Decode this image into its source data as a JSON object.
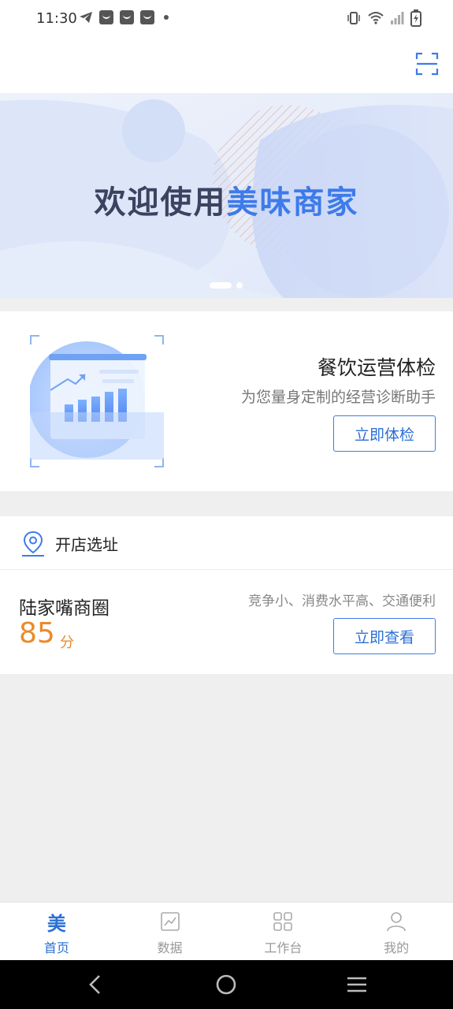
{
  "status_bar": {
    "time": "11:30",
    "notification_icons": [
      "telegram-icon",
      "mail-icon",
      "mail-icon",
      "mail-icon",
      "more-dot-icon"
    ],
    "system_icons": [
      "vibrate-icon",
      "wifi-icon",
      "signal-icon",
      "battery-icon"
    ]
  },
  "header": {
    "scan_icon": "scan-icon"
  },
  "banner": {
    "title_prefix": "欢迎使用",
    "title_highlight": "美味商家",
    "slide_count": 2,
    "active_slide": 1
  },
  "health_check": {
    "title": "餐饮运营体检",
    "subtitle": "为您量身定制的经营诊断助手",
    "button": "立即体检"
  },
  "site_selection": {
    "label": "开店选址",
    "area_name": "陆家嘴商圈",
    "score": "85",
    "score_unit": "分",
    "tags": "竞争小、消费水平高、交通便利",
    "button": "立即查看"
  },
  "tab_bar": {
    "items": [
      {
        "label": "首页",
        "icon_text": "美",
        "icon": "home-mei-icon",
        "active": true
      },
      {
        "label": "数据",
        "icon": "chart-icon",
        "active": false
      },
      {
        "label": "工作台",
        "icon": "grid-icon",
        "active": false
      },
      {
        "label": "我的",
        "icon": "user-icon",
        "active": false
      }
    ]
  },
  "colors": {
    "accent": "#2b6fd6",
    "score": "#e98b2a",
    "background": "#efefef"
  }
}
